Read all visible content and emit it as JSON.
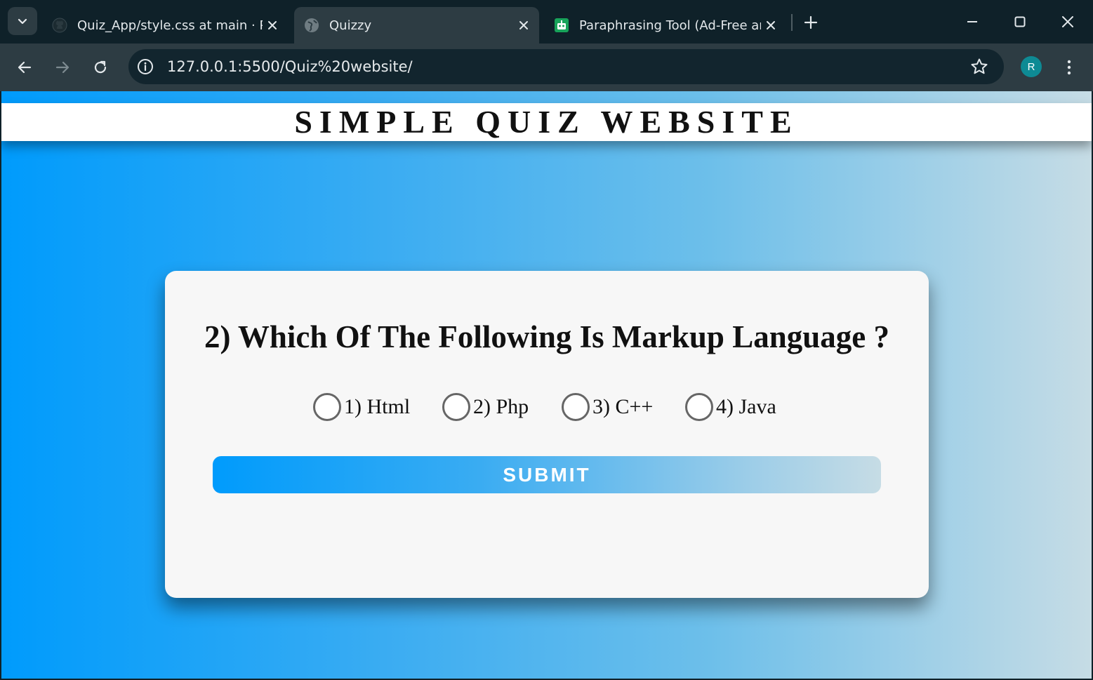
{
  "browser": {
    "tabs": [
      {
        "label": "Quiz_App/style.css at main · Par",
        "icon": "github-icon",
        "active": false
      },
      {
        "label": "Quizzy",
        "icon": "globe-icon",
        "active": true
      },
      {
        "label": "Paraphrasing Tool (Ad-Free and",
        "icon": "robot-icon",
        "active": false
      }
    ],
    "url": "127.0.0.1:5500/Quiz%20website/",
    "profile_initial": "R"
  },
  "page": {
    "site_title": "SIMPLE QUIZ WEBSITE",
    "question": "2) Which Of The Following Is Markup Language ?",
    "options": [
      {
        "label": "1) Html",
        "selected": false
      },
      {
        "label": "2) Php",
        "selected": false
      },
      {
        "label": "3) C++",
        "selected": false
      },
      {
        "label": "4) Java",
        "selected": false
      }
    ],
    "submit_label": "SUBMIT"
  },
  "colors": {
    "gradient_start": "#009bfc",
    "gradient_end": "#c6dce5",
    "card_background": "#f7f7f7",
    "browser_frame": "#0f2129",
    "toolbar": "#2d3c43"
  }
}
